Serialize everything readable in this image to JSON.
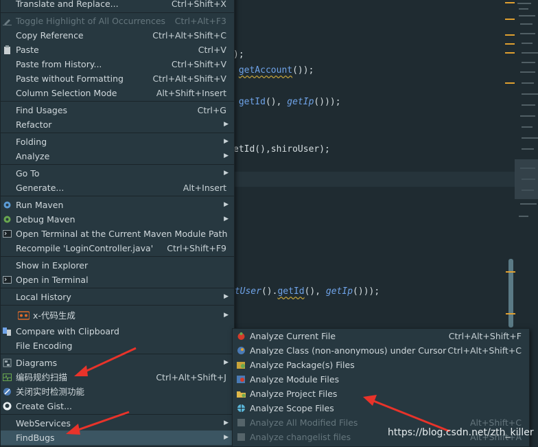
{
  "code": {
    "line1": ");",
    "line2_a": "getAccount",
    "line2_b": "());",
    "line3_a": "getId",
    "line3_b": "(), ",
    "line3_c": "getIp",
    "line3_d": "()));",
    "line4": "etId(),shiroUser);",
    "line5_a": "etUser",
    "line5_b": "().",
    "line5_c": "getId",
    "line5_d": "(), ",
    "line5_e": "getIp",
    "line5_f": "()));"
  },
  "main_menu": {
    "translate": {
      "label": "Translate and Replace...",
      "shortcut": "Ctrl+Shift+X"
    },
    "toggle_highlight": {
      "label": "Toggle Highlight of All Occurrences",
      "shortcut": "Ctrl+Alt+F3"
    },
    "copy_reference": {
      "label": "Copy Reference",
      "shortcut": "Ctrl+Alt+Shift+C"
    },
    "paste": {
      "label": "Paste",
      "shortcut": "Ctrl+V"
    },
    "paste_history": {
      "label": "Paste from History...",
      "shortcut": "Ctrl+Shift+V"
    },
    "paste_no_format": {
      "label": "Paste without Formatting",
      "shortcut": "Ctrl+Alt+Shift+V"
    },
    "column_selection": {
      "label": "Column Selection Mode",
      "shortcut": "Alt+Shift+Insert"
    },
    "find_usages": {
      "label": "Find Usages",
      "shortcut": "Ctrl+G"
    },
    "refactor": {
      "label": "Refactor"
    },
    "folding": {
      "label": "Folding"
    },
    "analyze": {
      "label": "Analyze"
    },
    "go_to": {
      "label": "Go To"
    },
    "generate": {
      "label": "Generate...",
      "shortcut": "Alt+Insert"
    },
    "run_maven": {
      "label": "Run Maven"
    },
    "debug_maven": {
      "label": "Debug Maven"
    },
    "open_terminal_maven": {
      "label": "Open Terminal at the Current Maven Module Path"
    },
    "recompile": {
      "label": "Recompile 'LoginController.java'",
      "shortcut": "Ctrl+Shift+F9"
    },
    "show_explorer": {
      "label": "Show in Explorer"
    },
    "open_terminal": {
      "label": "Open in Terminal"
    },
    "local_history": {
      "label": "Local History"
    },
    "x_codegen": {
      "label": "x-代码生成"
    },
    "compare_clipboard": {
      "label": "Compare with Clipboard"
    },
    "file_encoding": {
      "label": "File Encoding"
    },
    "diagrams": {
      "label": "Diagrams"
    },
    "code_scan": {
      "label": "编码规约扫描",
      "shortcut": "Ctrl+Alt+Shift+J"
    },
    "realtime_check": {
      "label": "关闭实时检测功能"
    },
    "create_gist": {
      "label": "Create Gist..."
    },
    "webservices": {
      "label": "WebServices"
    },
    "findbugs": {
      "label": "FindBugs"
    }
  },
  "findbugs_menu": {
    "current_file": {
      "label": "Analyze Current File",
      "shortcut": "Ctrl+Alt+Shift+F"
    },
    "class_cursor": {
      "label": "Analyze Class (non-anonymous) under Cursor",
      "shortcut": "Ctrl+Alt+Shift+C"
    },
    "package_files": {
      "label": "Analyze Package(s) Files"
    },
    "module_files": {
      "label": "Analyze Module Files"
    },
    "project_files": {
      "label": "Analyze Project Files"
    },
    "scope_files": {
      "label": "Analyze Scope Files"
    },
    "modified_files": {
      "label": "Analyze All Modified Files",
      "shortcut": "Alt+Shift+C"
    },
    "changelist_files": {
      "label": "Analyze changelist files",
      "shortcut": "Alt+Shift+A"
    }
  },
  "watermark": "https://blog.csdn.net/zth_killer",
  "colors": {
    "accent_arrow": "#e8332a",
    "menu_bg": "#273840",
    "selected_bg": "#3b5562"
  }
}
